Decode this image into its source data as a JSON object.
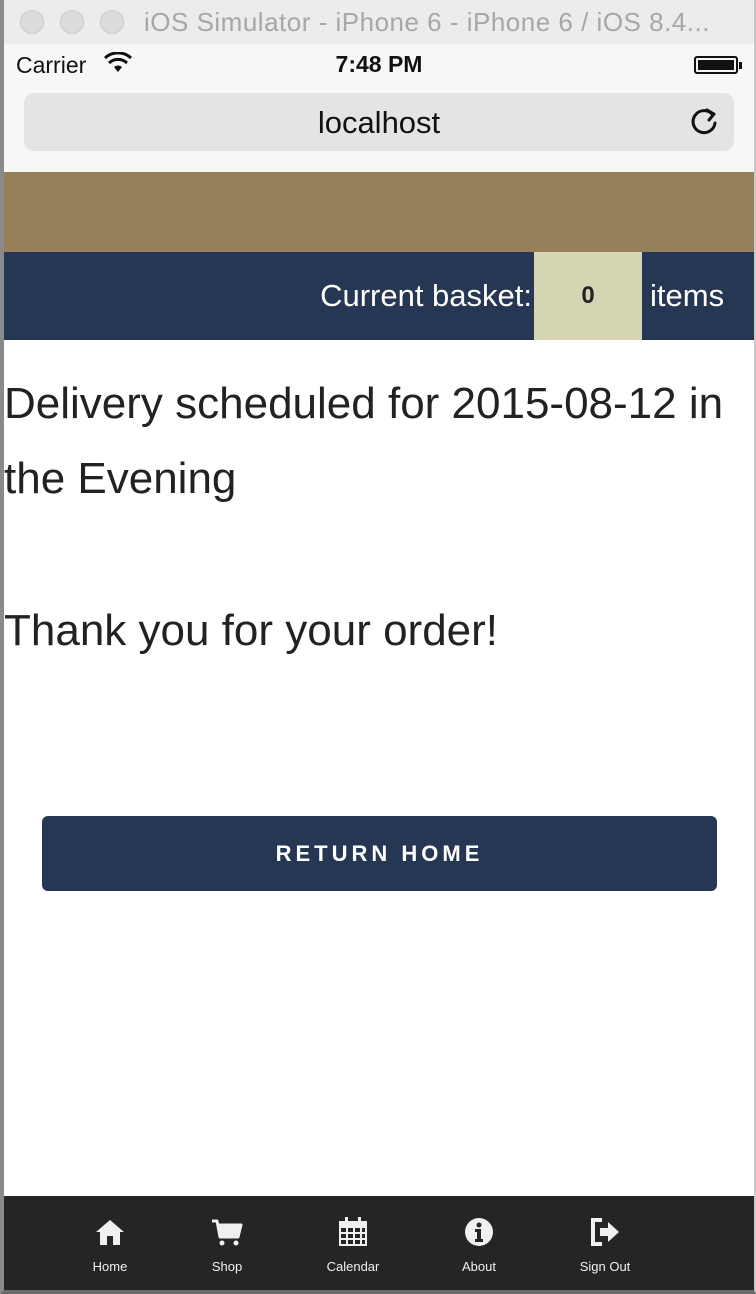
{
  "window": {
    "title": "iOS Simulator - iPhone 6 - iPhone 6 / iOS 8.4..."
  },
  "status_bar": {
    "carrier": "Carrier",
    "time": "7:48 PM"
  },
  "browser": {
    "url": "localhost"
  },
  "basket": {
    "label": "Current basket:",
    "count": "0",
    "unit": "items"
  },
  "confirmation": {
    "delivery_text": "Delivery scheduled for 2015-08-12 in the Evening",
    "thanks_text": "Thank you for your order!",
    "return_button": "RETURN HOME"
  },
  "tabbar": {
    "items": [
      {
        "label": "Home",
        "icon": "home-icon"
      },
      {
        "label": "Shop",
        "icon": "cart-icon"
      },
      {
        "label": "Calendar",
        "icon": "calendar-icon"
      },
      {
        "label": "About",
        "icon": "info-icon"
      },
      {
        "label": "Sign Out",
        "icon": "sign-out-icon"
      }
    ]
  },
  "colors": {
    "tan_band": "#968059",
    "navy": "#253752",
    "basket_count_bg": "#d5d5b3",
    "tabbar_bg": "#252525"
  }
}
